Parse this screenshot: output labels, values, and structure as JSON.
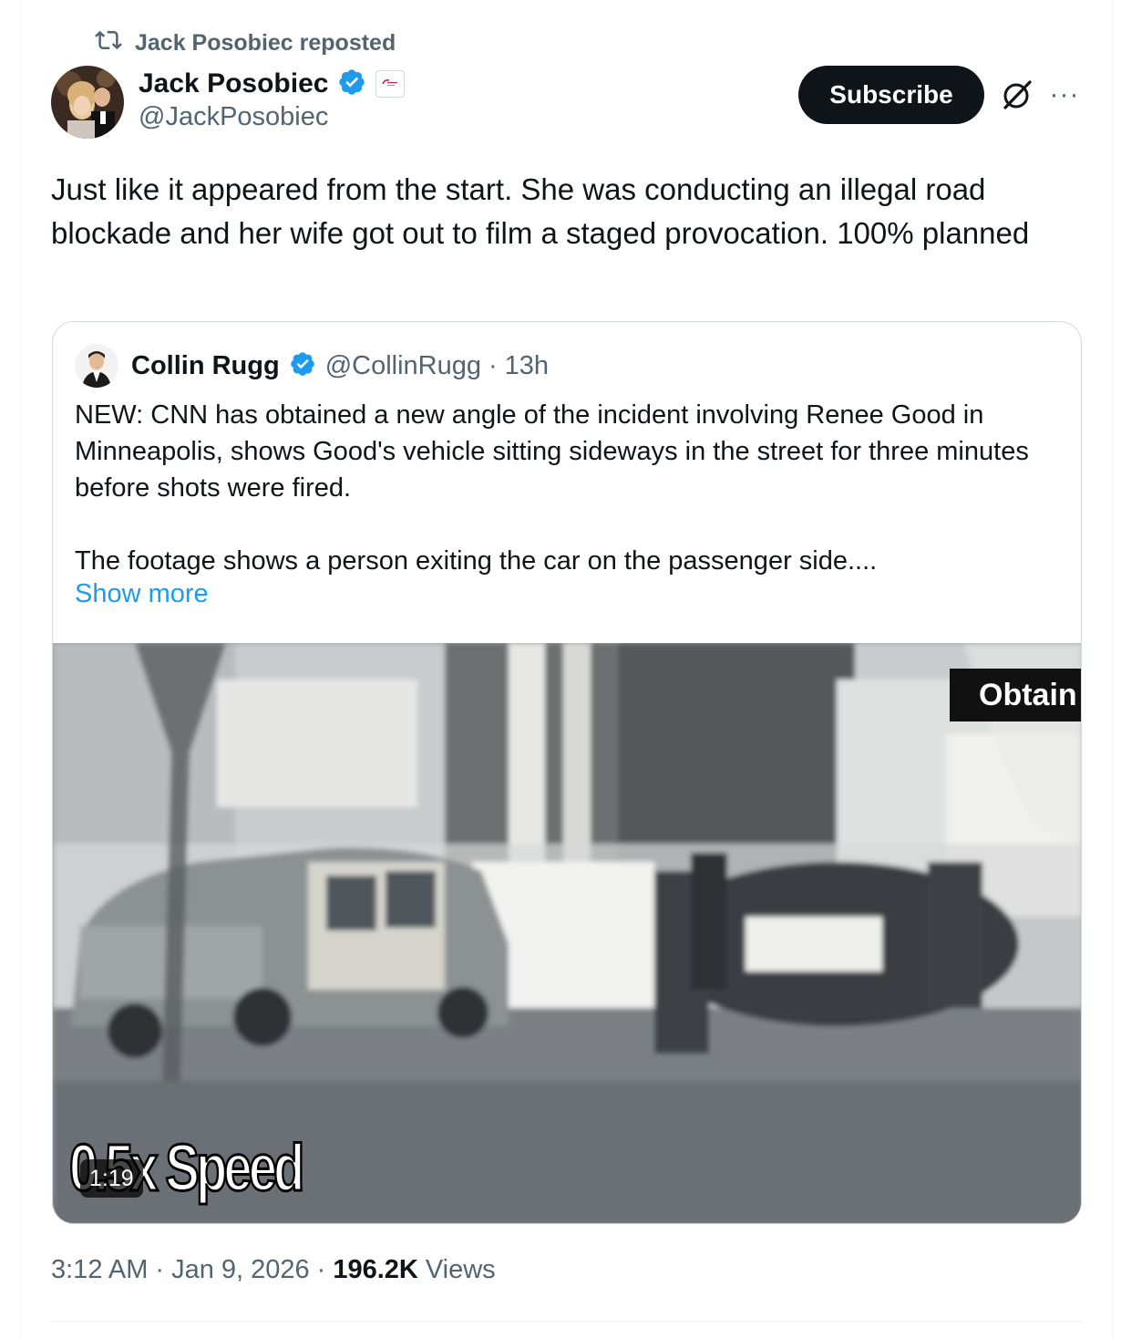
{
  "repost": {
    "label": "Jack Posobiec reposted"
  },
  "author": {
    "display_name": "Jack Posobiec",
    "handle": "@JackPosobiec"
  },
  "actions": {
    "subscribe_label": "Subscribe",
    "more_label": "···"
  },
  "post": {
    "text": "Just like it appeared from the start. She was conducting an illegal road blockade and her wife got out to film a staged provocation. 100% planned"
  },
  "quote": {
    "display_name": "Collin Rugg",
    "handle": "@CollinRugg",
    "separator": "·",
    "time": "13h",
    "paragraph1": "NEW: CNN has obtained a new angle of the incident involving Renee Good in Minneapolis, shows Good's vehicle sitting sideways in the street for three minutes before shots were fired.",
    "paragraph2": "The footage shows a person exiting the car on the passenger side....",
    "show_more": "Show more",
    "media": {
      "overlay_caption": "Obtain",
      "speed_caption": "0.5x Speed",
      "duration": "1:19"
    }
  },
  "footer": {
    "time": "3:12 AM",
    "sep1": "·",
    "date": "Jan 9, 2026",
    "sep2": "·",
    "views_count": "196.2K",
    "views_label": "Views"
  },
  "colors": {
    "text": "#0f1419",
    "secondary": "#536471",
    "link": "#1d9bf0",
    "verified": "#1d9bf0",
    "border": "#cfd9de"
  }
}
